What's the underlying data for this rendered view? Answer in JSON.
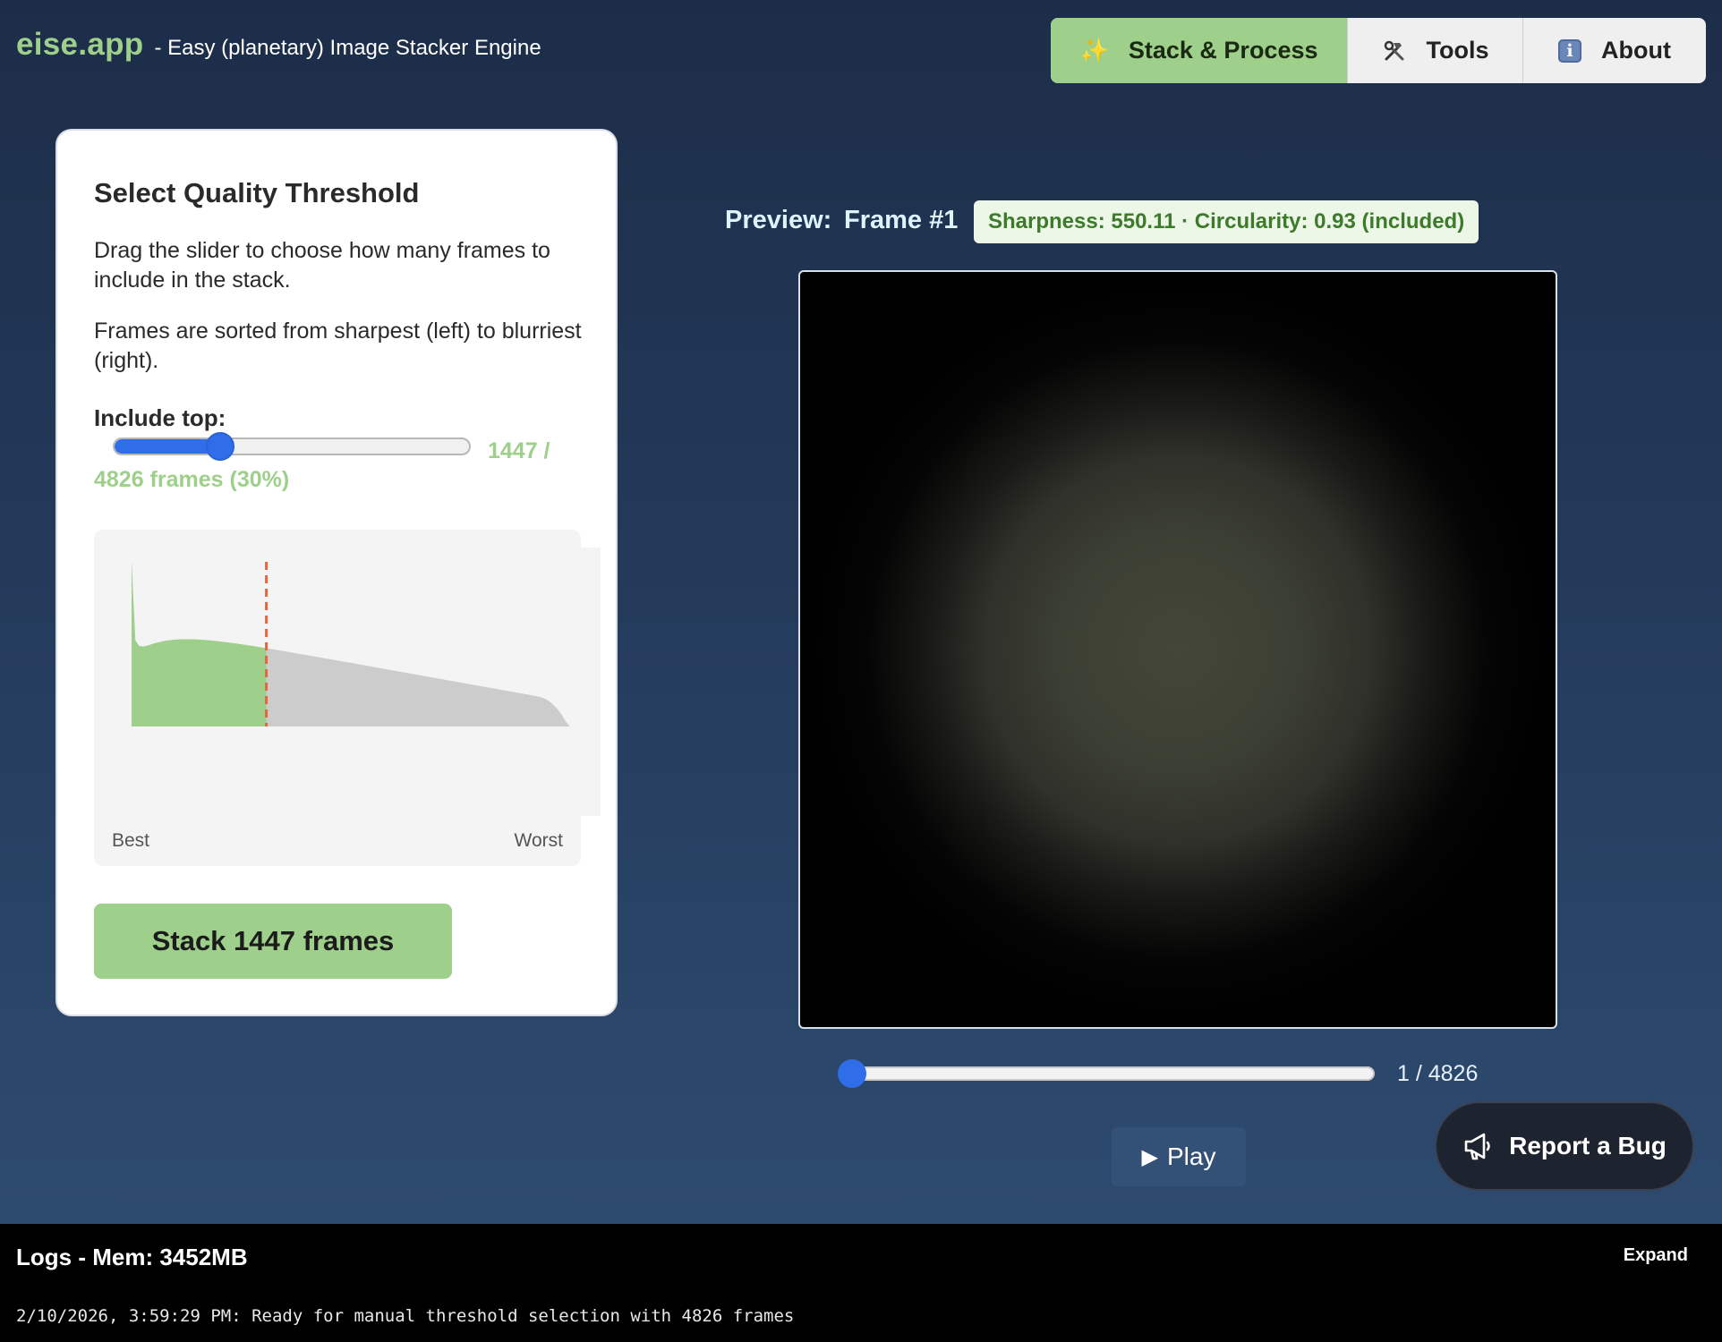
{
  "header": {
    "brand": "eise.app",
    "tagline": "- Easy (planetary) Image Stacker Engine"
  },
  "nav": {
    "tabs": [
      {
        "label": "Stack & Process",
        "icon": "sparkle-icon",
        "active": true
      },
      {
        "label": "Tools",
        "icon": "hammer-wrench-icon",
        "active": false
      },
      {
        "label": "About",
        "icon": "info-icon",
        "active": false
      }
    ]
  },
  "threshold": {
    "title": "Select Quality Threshold",
    "desc1": "Drag the slider to choose how many frames to include in the stack.",
    "desc2": "Frames are sorted from sharpest (left) to blurriest (right).",
    "include_label": "Include top:",
    "count_a": "1447 /",
    "count_b": "4826 frames (30%)",
    "selected_frames": 1447,
    "total_frames": 4826,
    "fraction": 0.3,
    "best_label": "Best",
    "worst_label": "Worst",
    "stack_button": "Stack 1447 frames",
    "colors": {
      "included": "#9ed08b",
      "excluded": "#cccccc",
      "marker": "#e8643c"
    }
  },
  "preview": {
    "label": "Preview:",
    "frame": "Frame #1",
    "metrics": "Sharpness: 550.11 · Circularity: 0.93 (included)",
    "counter": "1 / 4826",
    "current_frame": 1,
    "play_label": "Play"
  },
  "bug": {
    "label": "Report a Bug"
  },
  "logs": {
    "title": "Logs - Mem: 3452MB",
    "expand": "Expand",
    "line": "2/10/2026, 3:59:29 PM: Ready for manual threshold selection with 4826 frames"
  },
  "colors": {
    "accent_green": "#9ed08b",
    "slider_blue": "#2f6ee8",
    "metrics_text": "#3d7a2c"
  }
}
